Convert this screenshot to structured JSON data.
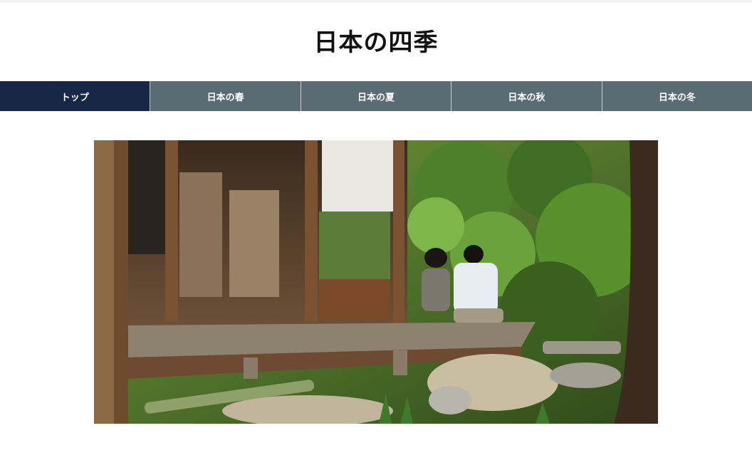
{
  "header": {
    "title": "日本の四季"
  },
  "nav": {
    "items": [
      {
        "label": "トップ",
        "active": true
      },
      {
        "label": "日本の春",
        "active": false
      },
      {
        "label": "日本の夏",
        "active": false
      },
      {
        "label": "日本の秋",
        "active": false
      },
      {
        "label": "日本の冬",
        "active": false
      }
    ]
  },
  "colors": {
    "nav_active": "#162845",
    "nav_default": "#5a6b74"
  }
}
